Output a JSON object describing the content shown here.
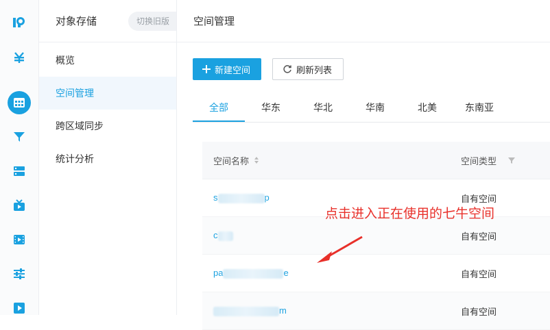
{
  "rail": {
    "icons": [
      "logo-icon",
      "yen-icon",
      "grid-icon",
      "funnel-icon",
      "server-icon",
      "tv-icon",
      "film-icon",
      "sliders-icon",
      "play-icon"
    ],
    "accent": "#1aa1e0"
  },
  "sidebar": {
    "title": "对象存储",
    "switch_label": "切换旧版",
    "items": [
      {
        "label": "概览"
      },
      {
        "label": "空间管理"
      },
      {
        "label": "跨区域同步"
      },
      {
        "label": "统计分析"
      }
    ]
  },
  "main": {
    "title": "空间管理",
    "new_button": "新建空间",
    "refresh_button": "刷新列表",
    "tabs": [
      "全部",
      "华东",
      "华北",
      "华南",
      "北美",
      "东南亚"
    ],
    "active_tab": "全部",
    "columns": {
      "name": "空间名称",
      "type": "空间类型"
    },
    "rows": [
      {
        "prefix": "s",
        "suffix": "p",
        "type": "自有空间"
      },
      {
        "prefix": "c",
        "suffix": "",
        "type": "自有空间"
      },
      {
        "prefix": "pa",
        "suffix": "e",
        "type": "自有空间"
      },
      {
        "prefix": "",
        "suffix": "m",
        "type": "自有空间"
      }
    ]
  },
  "annotation": {
    "text": "点击进入正在使用的七牛空间",
    "color": "#e8302a"
  }
}
